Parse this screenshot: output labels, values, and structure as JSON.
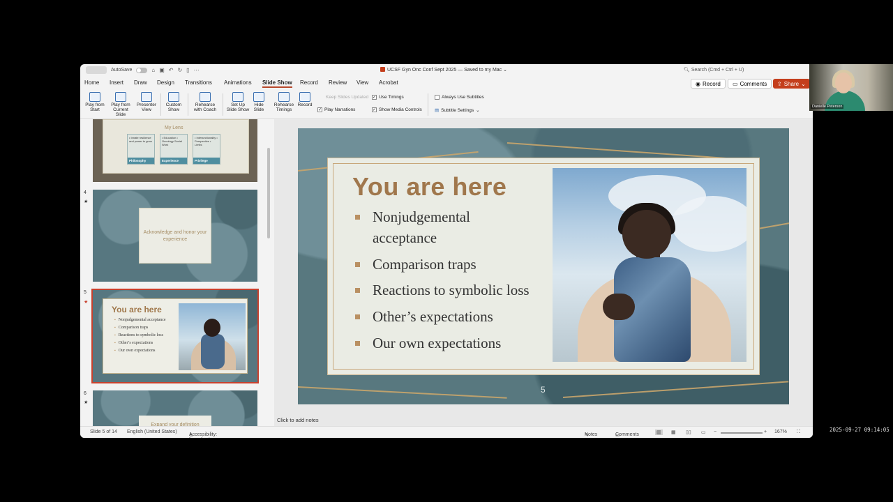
{
  "titlebar": {
    "autosave_label": "AutoSave",
    "doc_title": "UCSF Gyn Onc Conf Sept 2025 — Saved to my Mac ⌄",
    "search_placeholder": "Search (Cmd + Ctrl + U)"
  },
  "menu": {
    "tabs": [
      "Home",
      "Insert",
      "Draw",
      "Design",
      "Transitions",
      "Animations",
      "Slide Show",
      "Record",
      "Review",
      "View",
      "Acrobat"
    ],
    "active": "Slide Show"
  },
  "actions": {
    "record": "Record",
    "comments": "Comments",
    "share": "Share"
  },
  "ribbon": {
    "buttons": [
      {
        "l1": "Play from",
        "l2": "Start"
      },
      {
        "l1": "Play from",
        "l2": "Current Slide"
      },
      {
        "l1": "Presenter",
        "l2": "View"
      },
      {
        "l1": "Custom",
        "l2": "Show"
      },
      {
        "l1": "Rehearse",
        "l2": "with Coach"
      },
      {
        "l1": "Set Up",
        "l2": "Slide Show"
      },
      {
        "l1": "Hide",
        "l2": "Slide"
      },
      {
        "l1": "Rehearse",
        "l2": "Timings"
      },
      {
        "l1": "Record",
        "l2": ""
      }
    ],
    "keep_slides_updated": "Keep Slides Updated",
    "use_timings": "Use Timings",
    "play_narrations": "Play Narrations",
    "show_media_controls": "Show Media Controls",
    "always_use_subtitles": "Always Use Subtitles",
    "subtitle_settings": "Subtitle Settings"
  },
  "thumbnails": {
    "slide3": {
      "lens": "My Lens",
      "boxes": [
        {
          "text": "• Innate resilience and power to grow",
          "label": "Philosophy"
        },
        {
          "text": "• Education • Oncology Social Work",
          "label": "Experience"
        },
        {
          "text": "• Intersectionality • Perspective • Limits",
          "label": "Privilege"
        }
      ]
    },
    "slide4": {
      "num": "4",
      "star": "★",
      "text": "Acknowledge and honor your experience"
    },
    "slide5": {
      "num": "5",
      "star": "★",
      "title": "You are here",
      "items": [
        "Nonjudgemental acceptance",
        "Comparison traps",
        "Reactions to symbolic loss",
        "Other’s expectations",
        "Our own expectations"
      ]
    },
    "slide6": {
      "num": "6",
      "star": "★",
      "text": "Expand your definition"
    }
  },
  "slide": {
    "title": "You are here",
    "bullets": [
      "Nonjudgemental acceptance",
      "Comparison traps",
      "Reactions to symbolic loss",
      "Other’s expectations",
      "Our own expectations"
    ],
    "number": "5"
  },
  "notes_placeholder": "Click to add notes",
  "statusbar": {
    "slide_count": "Slide 5 of 14",
    "language": "English (United States)",
    "accessibility": "Accessibility: Investigate",
    "notes": "Notes",
    "comments": "Comments",
    "zoom": "167%"
  },
  "video": {
    "name": "Danielle Peterson"
  },
  "timestamp": "2025-09-27 09:14:05",
  "colors": {
    "accent": "#c43e1c",
    "title_brown": "#a0774c",
    "slide_bg": "#58787f"
  }
}
